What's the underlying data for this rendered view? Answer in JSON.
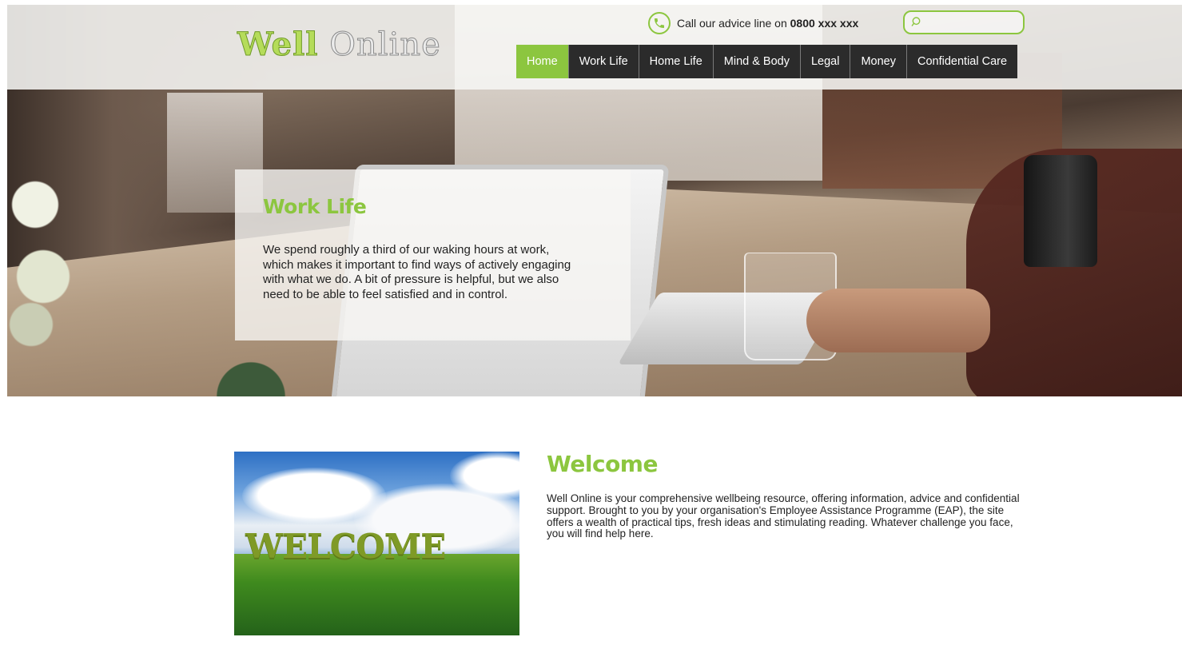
{
  "brand": {
    "logo_part1": "Well",
    "logo_part2": " Online",
    "accent_color": "#8cc63f",
    "nav_bg_color": "#2b2b2b"
  },
  "header": {
    "advice_prefix": "Call our advice line on ",
    "advice_number": "0800 xxx xxx",
    "phone_icon": "phone-icon",
    "search_icon": "search-icon",
    "search_value": ""
  },
  "nav": {
    "items": [
      {
        "label": "Home",
        "active": true
      },
      {
        "label": "Work Life",
        "active": false
      },
      {
        "label": "Home Life",
        "active": false
      },
      {
        "label": "Mind & Body",
        "active": false
      },
      {
        "label": "Legal",
        "active": false
      },
      {
        "label": "Money",
        "active": false
      },
      {
        "label": "Confidential Care",
        "active": false
      }
    ]
  },
  "hero": {
    "title": "Work Life",
    "body": "We spend roughly a third of our waking hours at work, which makes it important to find ways of actively engaging with what we do. A bit of pressure is helpful, but we also need to be able to feel satisfied and in control."
  },
  "welcome": {
    "image_word": "WELCOME",
    "title": "Welcome",
    "body": "Well Online is your comprehensive wellbeing resource, offering information, advice and confidential support. Brought to you by your organisation's Employee Assistance Programme (EAP), the site offers a wealth of practical tips, fresh ideas and stimulating reading. Whatever challenge you face, you will find help here."
  }
}
